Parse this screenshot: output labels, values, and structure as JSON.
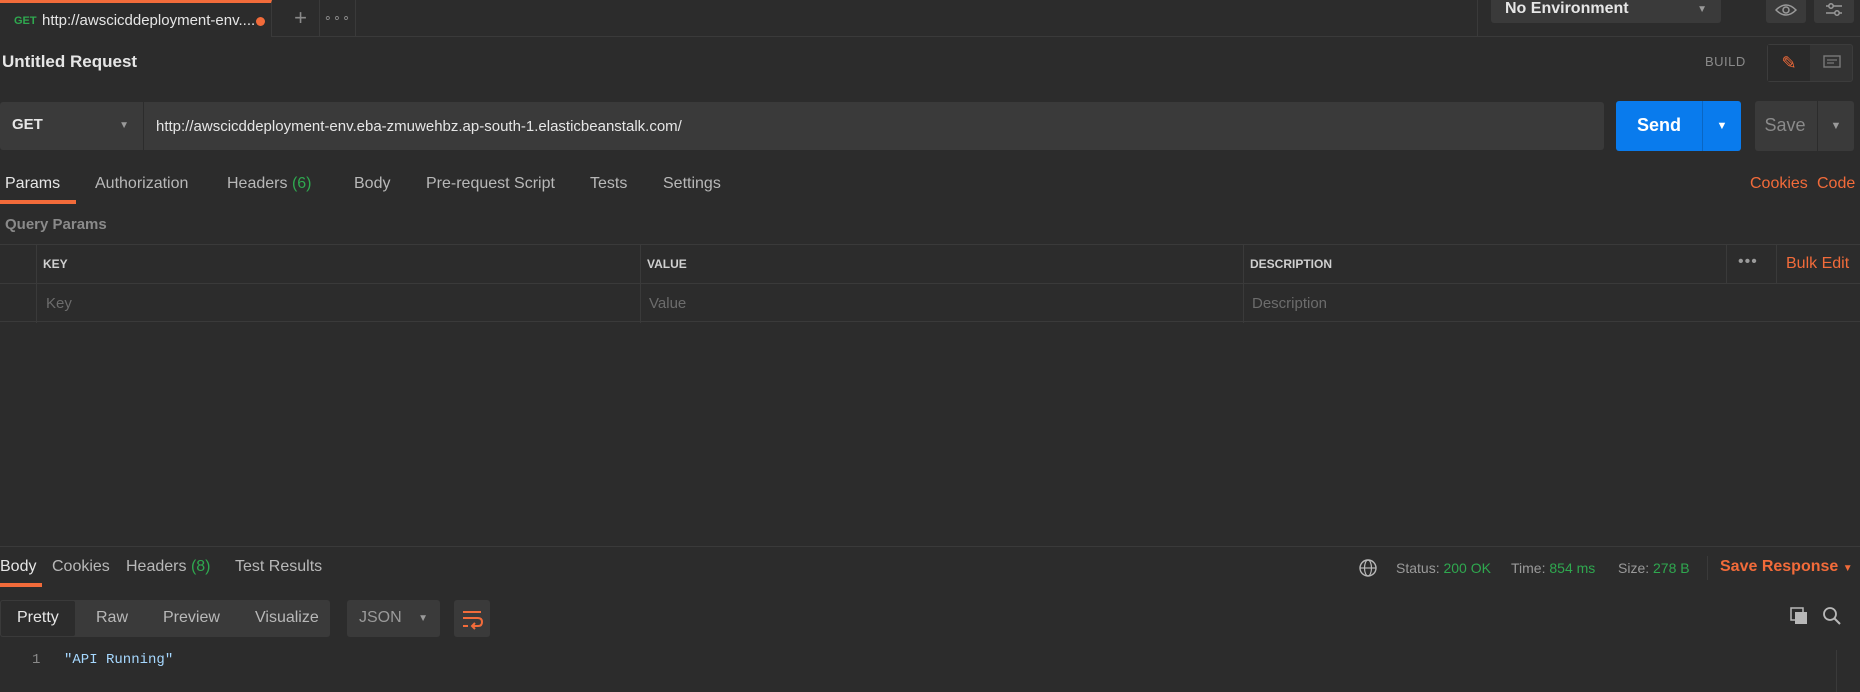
{
  "tab": {
    "method": "GET",
    "title": "http://awscicddeployment-env....",
    "new_tab": "+",
    "more": "∘∘∘"
  },
  "environment": {
    "selected": "No Environment"
  },
  "request": {
    "name": "Untitled Request",
    "build_label": "BUILD",
    "method": "GET",
    "url": "http://awscicddeployment-env.eba-zmuwehbz.ap-south-1.elasticbeanstalk.com/",
    "send_label": "Send",
    "save_label": "Save"
  },
  "request_tabs": [
    {
      "label": "Params",
      "count": ""
    },
    {
      "label": "Authorization",
      "count": ""
    },
    {
      "label": "Headers",
      "count": "(6)"
    },
    {
      "label": "Body",
      "count": ""
    },
    {
      "label": "Pre-request Script",
      "count": ""
    },
    {
      "label": "Tests",
      "count": ""
    },
    {
      "label": "Settings",
      "count": ""
    }
  ],
  "links": {
    "cookies": "Cookies",
    "code": "Code"
  },
  "query_params": {
    "title": "Query Params",
    "columns": [
      "KEY",
      "VALUE",
      "DESCRIPTION"
    ],
    "placeholders": {
      "key": "Key",
      "value": "Value",
      "description": "Description"
    },
    "bulk_edit": "Bulk Edit",
    "more": "•••"
  },
  "response": {
    "tabs": [
      {
        "label": "Body",
        "count": ""
      },
      {
        "label": "Cookies",
        "count": ""
      },
      {
        "label": "Headers",
        "count": "(8)"
      },
      {
        "label": "Test Results",
        "count": ""
      }
    ],
    "status_label": "Status:",
    "status_value": "200 OK",
    "time_label": "Time:",
    "time_value": "854 ms",
    "size_label": "Size:",
    "size_value": "278 B",
    "save_response": "Save Response",
    "formats": [
      "Pretty",
      "Raw",
      "Preview",
      "Visualize"
    ],
    "language": "JSON",
    "lines": [
      {
        "num": "1",
        "text": "\"API Running\""
      }
    ]
  },
  "colors": {
    "accent": "#f26b3a",
    "send_blue": "#097bed",
    "success_green": "#2fa84f",
    "background": "#2c2c2c"
  }
}
